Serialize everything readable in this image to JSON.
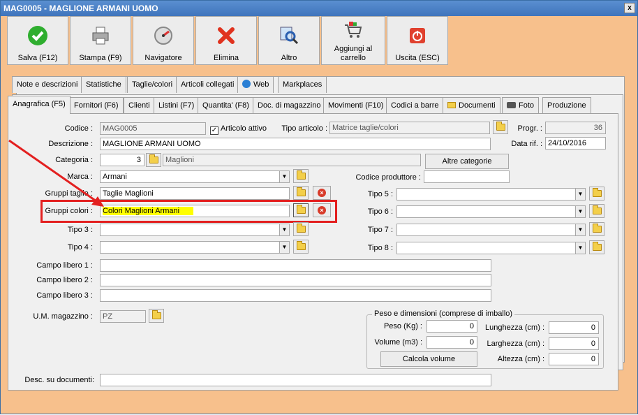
{
  "window": {
    "title": "MAG0005 - MAGLIONE ARMANI UOMO",
    "close_label": "x"
  },
  "toolbar": [
    {
      "label": "Salva (F12)",
      "icon": "check-icon"
    },
    {
      "label": "Stampa (F9)",
      "icon": "printer-icon"
    },
    {
      "label": "Navigatore",
      "icon": "compass-icon"
    },
    {
      "label": "Elimina",
      "icon": "delete-x-icon"
    },
    {
      "label": "Altro",
      "icon": "magnifier-icon"
    },
    {
      "label_line1": "Aggiungi al",
      "label_line2": "carrello",
      "icon": "cart-icon"
    },
    {
      "label": "Uscita (ESC)",
      "icon": "power-icon"
    }
  ],
  "tabs_row1": [
    "Note e descrizioni",
    "Statistiche",
    "Taglie/colori",
    "Articoli collegati",
    "Web",
    "Markplaces"
  ],
  "tabs_row2": [
    "Anagrafica (F5)",
    "Fornitori (F6)",
    "Clienti",
    "Listini (F7)",
    "Quantita' (F8)",
    "Doc. di magazzino",
    "Movimenti (F10)",
    "Codici a barre",
    "Documenti",
    "Foto",
    "Produzione"
  ],
  "form": {
    "codice_label": "Codice :",
    "codice_value": "MAG0005",
    "articolo_attivo_label": "Articolo attivo",
    "articolo_attivo_checked": "✓",
    "tipo_articolo_label": "Tipo articolo :",
    "tipo_articolo_value": "Matrice taglie/colori",
    "progr_label": "Progr. :",
    "progr_value": "36",
    "descrizione_label": "Descrizione :",
    "descrizione_value": "MAGLIONE ARMANI UOMO",
    "data_rif_label": "Data rif. :",
    "data_rif_value": "24/10/2016",
    "categoria_label": "Categoria :",
    "categoria_code": "3",
    "categoria_name": "Maglioni",
    "altre_categorie_label": "Altre categorie",
    "marca_label": "Marca :",
    "marca_value": "Armani",
    "codice_produttore_label": "Codice produttore :",
    "codice_produttore_value": "",
    "gruppi_taglie_label": "Gruppi taglie :",
    "gruppi_taglie_value": "Taglie Maglioni",
    "gruppi_colori_label": "Gruppi colori :",
    "gruppi_colori_value": "Colori Maglioni Armani",
    "tipo3_label": "Tipo 3 :",
    "tipo4_label": "Tipo 4 :",
    "tipo5_label": "Tipo 5 :",
    "tipo6_label": "Tipo 6 :",
    "tipo7_label": "Tipo 7 :",
    "tipo8_label": "Tipo 8 :",
    "campo1_label": "Campo libero 1 :",
    "campo2_label": "Campo libero 2 :",
    "campo3_label": "Campo libero 3 :",
    "um_label": "U.M. magazzino :",
    "um_value": "PZ",
    "peso_group_title": "Peso e dimensioni (comprese di imballo)",
    "peso_label": "Peso (Kg) :",
    "peso_value": "0",
    "volume_label": "Volume (m3) :",
    "volume_value": "0",
    "calcola_volume_label": "Calcola volume",
    "lunghezza_label": "Lunghezza (cm) :",
    "lunghezza_value": "0",
    "larghezza_label": "Larghezza (cm) :",
    "larghezza_value": "0",
    "altezza_label": "Altezza (cm) :",
    "altezza_value": "0",
    "desc_documenti_label": "Desc. su documenti:"
  },
  "colors": {
    "highlight_border": "#e32020",
    "highlight_fill": "#ffff00",
    "background": "#f7c08c"
  }
}
